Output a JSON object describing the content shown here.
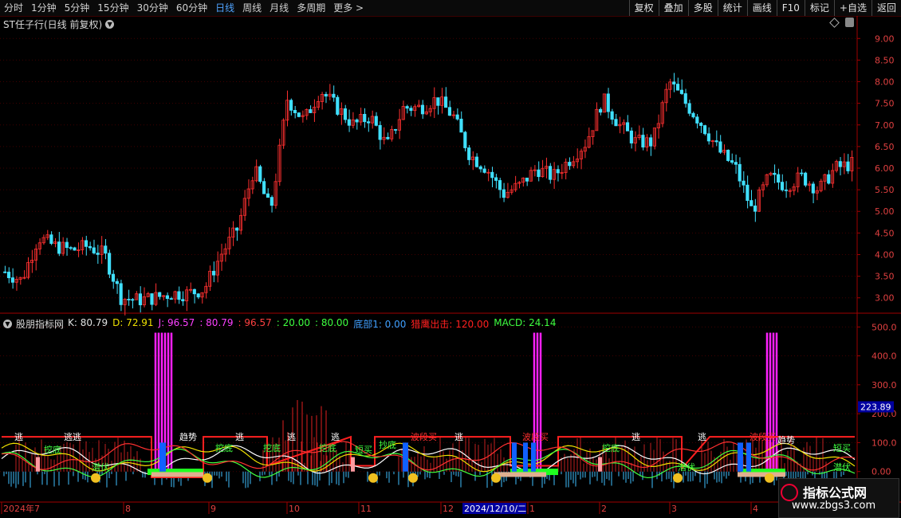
{
  "toolbar": {
    "left": [
      {
        "label": "分时",
        "active": false
      },
      {
        "label": "1分钟",
        "active": false
      },
      {
        "label": "5分钟",
        "active": false
      },
      {
        "label": "15分钟",
        "active": false
      },
      {
        "label": "30分钟",
        "active": false
      },
      {
        "label": "60分钟",
        "active": false
      },
      {
        "label": "日线",
        "active": true
      },
      {
        "label": "周线",
        "active": false
      },
      {
        "label": "月线",
        "active": false
      },
      {
        "label": "多周期",
        "active": false
      },
      {
        "label": "更多 >",
        "active": false
      }
    ],
    "right": [
      "复权",
      "叠加",
      "多股",
      "统计",
      "画线",
      "F10",
      "标记",
      "+自选",
      "返回"
    ]
  },
  "main_chart": {
    "title": "ST任子行(日线 前复权)",
    "y_ticks": [
      "9.00",
      "8.50",
      "8.00",
      "7.50",
      "7.00",
      "6.50",
      "6.00",
      "5.50",
      "5.00",
      "4.50",
      "4.00",
      "3.50",
      "3.00"
    ],
    "y_values": [
      9.0,
      8.5,
      8.0,
      7.5,
      7.0,
      6.5,
      6.0,
      5.5,
      5.0,
      4.5,
      4.0,
      3.5,
      3.0
    ]
  },
  "indicator": {
    "name": "股朋指标网",
    "values": [
      {
        "text": "K: 80.79",
        "color": "#e0e0e0"
      },
      {
        "text": "D: 72.91",
        "color": "#f0e000"
      },
      {
        "text": "J: 96.57",
        "color": "#ff40ff"
      },
      {
        "text": ": 80.79",
        "color": "#ff40ff"
      },
      {
        "text": ": 96.57",
        "color": "#ff4040"
      },
      {
        "text": ": 20.00",
        "color": "#40ff40"
      },
      {
        "text": ": 80.00",
        "color": "#40ff40"
      },
      {
        "text": "底部1: 0.00",
        "color": "#40a0ff"
      },
      {
        "text": "猎鹰出击: 120.00",
        "color": "#ff2020"
      },
      {
        "text": "MACD: 24.14",
        "color": "#40ff40"
      }
    ],
    "y_ticks": [
      "500.0",
      "400.0",
      "300.0",
      "200.0",
      "100.0",
      "0.00"
    ],
    "y_values": [
      500,
      400,
      300,
      200,
      100,
      0
    ],
    "current_value": "223.89"
  },
  "x_axis": {
    "labels": [
      "2024年7",
      "8",
      "9",
      "10",
      "11",
      "12",
      "1",
      "2",
      "3",
      "4"
    ],
    "highlight": "2024/12/10/二"
  },
  "annotations": {
    "escape": "逃",
    "escape2": "逃逃",
    "dig_bottom": "挖底",
    "bottom_pick": "抄底",
    "lie_low": "潜伏",
    "trend": "趋势",
    "wave_buy": "波段买",
    "trade": "短买"
  },
  "watermark": {
    "line1": "指标公式网",
    "line2": "www.zbgs3.com"
  },
  "chart_data": {
    "type": "candlestick",
    "title": "ST任子行(日线 前复权)",
    "ylim": [
      2.7,
      9.3
    ],
    "x_months": [
      "2024年7",
      "8",
      "9",
      "10",
      "11",
      "12",
      "1",
      "2",
      "3",
      "4"
    ],
    "close_trend": [
      3.6,
      3.4,
      4.4,
      4.2,
      4.1,
      4.2,
      4.0,
      3.0,
      2.95,
      3.0,
      3.1,
      3.1,
      3.2,
      4.0,
      4.6,
      6.0,
      5.0,
      7.6,
      7.1,
      7.8,
      7.4,
      7.0,
      7.2,
      6.5,
      7.4,
      7.4,
      7.6,
      7.2,
      6.3,
      6.0,
      5.4,
      5.6,
      6.0,
      5.8,
      6.2,
      6.6,
      7.6,
      7.0,
      6.6,
      6.6,
      8.0,
      7.5,
      7.0,
      6.4,
      6.0,
      5.0,
      5.8,
      5.6,
      5.8,
      5.5,
      6.0,
      6.1
    ],
    "indicator_ylim": [
      -100,
      520
    ]
  }
}
